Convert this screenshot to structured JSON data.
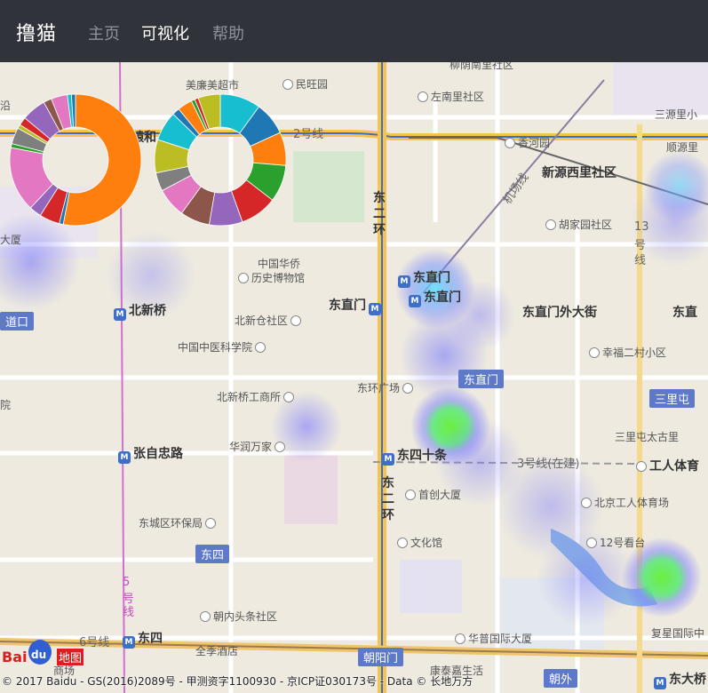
{
  "navbar": {
    "brand": "撸猫",
    "items": [
      {
        "label": "主页",
        "active": false
      },
      {
        "label": "可视化",
        "active": true
      },
      {
        "label": "帮助",
        "active": false
      }
    ]
  },
  "map": {
    "labels": {
      "meilian": "美廉美超市",
      "minwang": "民旺园",
      "liuyinnan": "柳荫南里社区",
      "zuonan": "左南里社区",
      "sanyuanli": "三源里小",
      "xiangheyuan": "香河园",
      "xinyuan": "新源西里社区",
      "shunyuan": "顺源里",
      "huguang": "胡家园社区",
      "dasha": "大厦",
      "zhonghuaqiao": "中国华侨",
      "lishibowuguan": "历史博物馆",
      "beixinqiao": "北新桥",
      "dongzhimen": "东直门",
      "dongzhimen_station": "东直门",
      "dongzhimen_waidajie": "东直门外大街",
      "dongzhi_right": "东直",
      "beixincang": "北新仓社区",
      "kexueyuan": "中国中医科学院",
      "xingfu": "幸福二村小区",
      "donghuan_guangchang": "东环广场",
      "dongzhimen_tag": "东直门",
      "sanlitun_tag": "三里屯",
      "beixinqiao_shangchang": "北新桥工商所",
      "sanlitun_taigu": "三里屯太古里",
      "huarun": "华润万家",
      "dongsishitiao": "东四十条",
      "zhangzizhonglu": "张自忠路",
      "line3": "3号线(在建)",
      "gongrentiyu": "工人体育",
      "shouchuang": "首创大厦",
      "beijing_gongti": "北京工人体育场",
      "dongcheng_huanbao": "东城区环保局",
      "wenhuaguan": "文化馆",
      "kantai12": "12号看台",
      "dongsi_tag": "东四",
      "chaonei": "朝内头条社区",
      "fujie": "复星国际中",
      "line6": "6号线",
      "dongsi": "东四",
      "quanji": "全季酒店",
      "huamao": "华普国际大厦",
      "chaoyangmen_tag": "朝阳门",
      "chaowai_tag": "朝外",
      "dongdaqiao": "东大桥",
      "kangtai": "康泰嘉生活",
      "shangchang": "商场",
      "daokou": "道口",
      "yuan": "院",
      "zhuanhe": "辕和",
      "yan": "沿",
      "donghuan_a": "东",
      "donghuan_b": "二",
      "donghuan_c": "环",
      "donghuan2_a": "东",
      "donghuan2_b": "二",
      "donghuan2_c": "环",
      "line2": "2号线",
      "line5_a": "5",
      "line5_b": "号",
      "line5_c": "线",
      "line13_a": "13",
      "line13_b": "号",
      "line13_c": "线",
      "jichang": "机场线",
      "dongzhimen_lbl": "东直门",
      "dongsiwei": "东四十条"
    },
    "copyright": "© 2017 Baidu - GS(2016)2089号 - 甲测资字1100930 - 京ICP证030173号 - Data © 长地万方",
    "logo_text": "Bai",
    "logo_du": "du",
    "logo_cn": "地图"
  },
  "chart_data": [
    {
      "type": "pie",
      "shape": "donut",
      "slices": [
        {
          "color": "#ff7f0e",
          "value": 0.53
        },
        {
          "color": "#1f77b4",
          "value": 0.01
        },
        {
          "color": "#d62728",
          "value": 0.05
        },
        {
          "color": "#9467bd",
          "value": 0.03
        },
        {
          "color": "#e377c2",
          "value": 0.16
        },
        {
          "color": "#2ca02c",
          "value": 0.01
        },
        {
          "color": "#7f7f7f",
          "value": 0.04
        },
        {
          "color": "#bcbd22",
          "value": 0.01
        },
        {
          "color": "#d62728",
          "value": 0.02
        },
        {
          "color": "#9467bd",
          "value": 0.06
        },
        {
          "color": "#8c564b",
          "value": 0.02
        },
        {
          "color": "#e377c2",
          "value": 0.04
        },
        {
          "color": "#17becf",
          "value": 0.01
        },
        {
          "color": "#1f77b4",
          "value": 0.01
        }
      ]
    },
    {
      "type": "pie",
      "shape": "donut",
      "slices": [
        {
          "color": "#17becf",
          "value": 0.11
        },
        {
          "color": "#1f77b4",
          "value": 0.09
        },
        {
          "color": "#ff7f0e",
          "value": 0.09
        },
        {
          "color": "#2ca02c",
          "value": 0.1
        },
        {
          "color": "#d62728",
          "value": 0.1
        },
        {
          "color": "#9467bd",
          "value": 0.09
        },
        {
          "color": "#8c564b",
          "value": 0.08
        },
        {
          "color": "#e377c2",
          "value": 0.08
        },
        {
          "color": "#7f7f7f",
          "value": 0.05
        },
        {
          "color": "#bcbd22",
          "value": 0.09
        },
        {
          "color": "#17becf",
          "value": 0.08
        },
        {
          "color": "#1f77b4",
          "value": 0.02
        },
        {
          "color": "#ff7f0e",
          "value": 0.04
        },
        {
          "color": "#2ca02c",
          "value": 0.01
        },
        {
          "color": "#d62728",
          "value": 0.01
        },
        {
          "color": "#bcbd22",
          "value": 0.06
        }
      ]
    }
  ]
}
